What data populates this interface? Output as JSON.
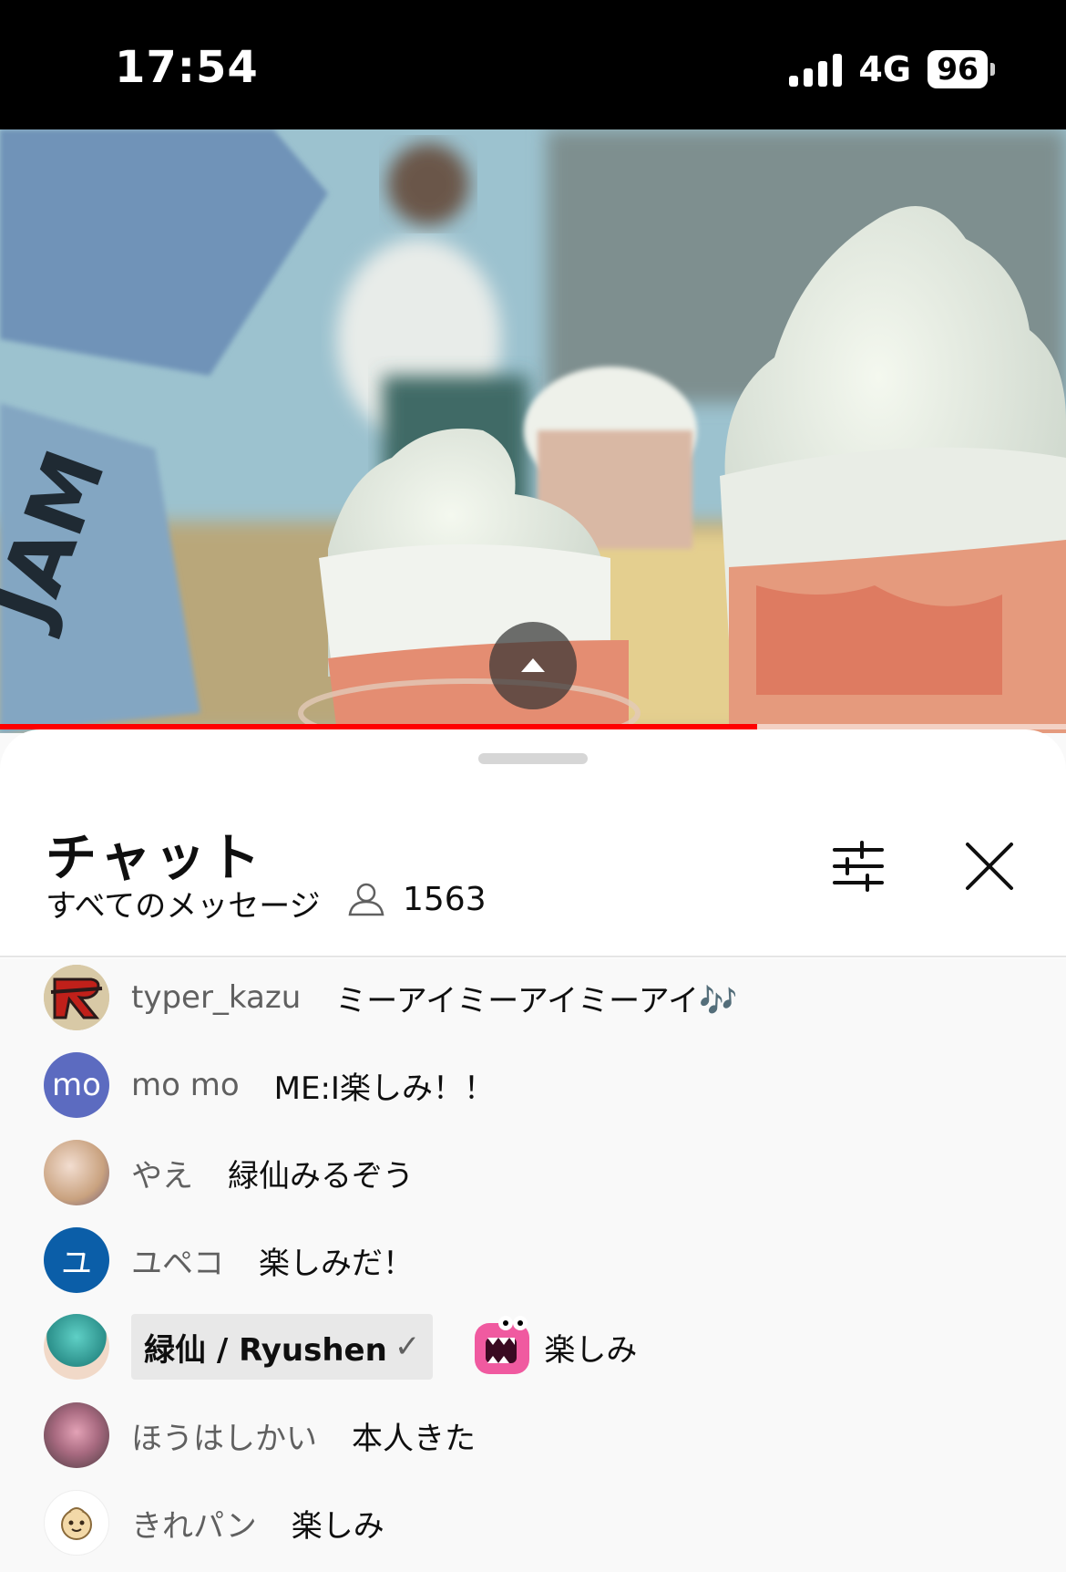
{
  "status_bar": {
    "time": "17:54",
    "network": "4G",
    "battery": "96"
  },
  "video": {
    "progress_percent": 71,
    "play_toggle_icon": "chevron-up-icon"
  },
  "chat": {
    "title": "チャット",
    "filter_label": "すべてのメッセージ",
    "viewer_count": "1563",
    "messages": [
      {
        "author": "typer_kazu",
        "text": "ミーアイミーアイミーアイ🎶",
        "avatar_color": "#d8c9a6",
        "avatar_text": ""
      },
      {
        "author": "mo mo",
        "text": "ME:I楽しみ！！",
        "avatar_color": "#5c6bc0",
        "avatar_text": "mo"
      },
      {
        "author": "やえ",
        "text": "緑仙みるぞう",
        "avatar_color": "#c9a27f",
        "avatar_text": ""
      },
      {
        "author": "ユペコ",
        "text": "楽しみだ！",
        "avatar_color": "#0b5ea8",
        "avatar_text": "ユ"
      },
      {
        "author": "緑仙 / Ryushen",
        "owner_check": "✓",
        "text": "楽しみ",
        "avatar_color": "#3aa6a0",
        "avatar_text": ""
      },
      {
        "author": "ほうはしかい",
        "text": "本人きた",
        "avatar_color": "#7a5560",
        "avatar_text": ""
      },
      {
        "author": "きれパン",
        "text": "楽しみ",
        "avatar_color": "#ffffff",
        "avatar_text": ""
      }
    ]
  },
  "colors": {
    "progress": "#ff0000",
    "text_primary": "#0f0f0f",
    "text_secondary": "#606060"
  }
}
